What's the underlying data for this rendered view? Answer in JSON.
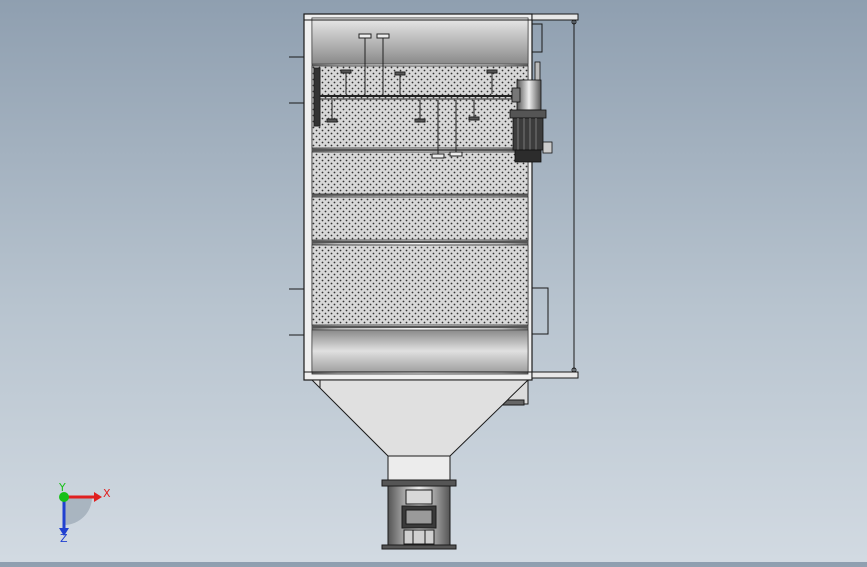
{
  "triad": {
    "x_label": "X",
    "y_label": "Y",
    "z_label": "Z",
    "colors": {
      "x": "#e02020",
      "y": "#18c018",
      "z": "#2040d0"
    }
  },
  "colors": {
    "frame": "#f2f2f2",
    "panel_dark": "#4a4a4a",
    "outline": "#1a1a1a",
    "hopper": "#d9d9d9",
    "motor": "#3c3c3c"
  },
  "icons": [
    "dimension-line-icon",
    "motor-icon",
    "bag-filter-icon",
    "triad-icon"
  ]
}
